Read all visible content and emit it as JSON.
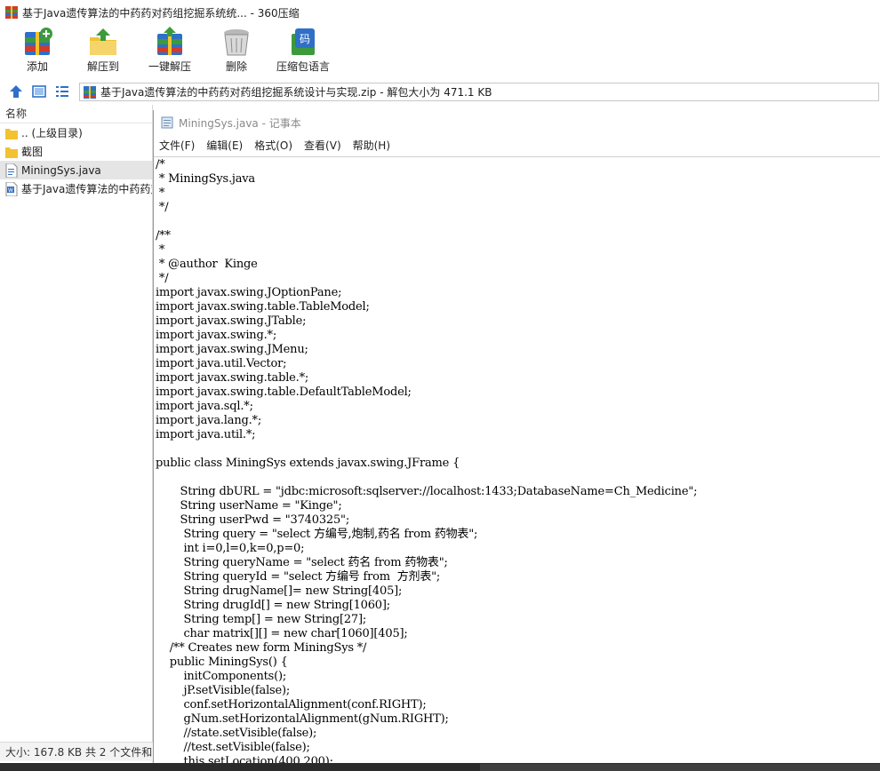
{
  "window": {
    "title": "基于Java遗传算法的中药药对药组挖掘系统统... - 360压缩"
  },
  "toolbar": {
    "buttons": [
      {
        "label": "添加",
        "icon": "add-archive-icon"
      },
      {
        "label": "解压到",
        "icon": "extract-to-folder-icon"
      },
      {
        "label": "一键解压",
        "icon": "one-click-extract-icon"
      },
      {
        "label": "删除",
        "icon": "delete-trash-icon"
      },
      {
        "label": "压缩包语言",
        "icon": "archive-language-code-icon"
      }
    ]
  },
  "addressbar": {
    "path": "基于Java遗传算法的中药药对药组挖掘系统设计与实现.zip - 解包大小为 471.1 KB"
  },
  "filelist": {
    "header": "名称",
    "items": [
      {
        "name": ".. (上级目录)",
        "type": "folder"
      },
      {
        "name": "截图",
        "type": "folder"
      },
      {
        "name": "MiningSys.java",
        "type": "java"
      },
      {
        "name": "基于Java遗传算法的中药药对",
        "type": "doc"
      }
    ]
  },
  "status": {
    "text": "大小: 167.8 KB 共 2 个文件和"
  },
  "notepad": {
    "title": "MiningSys.java - 记事本",
    "menu": [
      "文件(F)",
      "编辑(E)",
      "格式(O)",
      "查看(V)",
      "帮助(H)"
    ],
    "content": "/*\n * MiningSys.java\n *\n */\n\n/**\n *\n * @author  Kinge\n */\nimport javax.swing.JOptionPane;\nimport javax.swing.table.TableModel;\nimport javax.swing.JTable;\nimport javax.swing.*;\nimport javax.swing.JMenu;\nimport java.util.Vector;\nimport javax.swing.table.*;\nimport javax.swing.table.DefaultTableModel;\nimport java.sql.*;\nimport java.lang.*;\nimport java.util.*;\n\npublic class MiningSys extends javax.swing.JFrame {\n\n       String dbURL = \"jdbc:microsoft:sqlserver://localhost:1433;DatabaseName=Ch_Medicine\";\n       String userName = \"Kinge\";\n       String userPwd = \"3740325\";\n        String query = \"select 方编号,炮制,药名 from 药物表\";\n        int i=0,l=0,k=0,p=0;\n        String queryName = \"select 药名 from 药物表\";\n        String queryId = \"select 方编号 from  方剂表\";\n        String drugName[]= new String[405];\n        String drugId[] = new String[1060];\n        String temp[] = new String[27];\n        char matrix[][] = new char[1060][405];\n    /** Creates new form MiningSys */\n    public MiningSys() {\n        initComponents();\n        jP.setVisible(false);\n        conf.setHorizontalAlignment(conf.RIGHT);\n        gNum.setHorizontalAlignment(gNum.RIGHT);\n        //state.setVisible(false);\n        //test.setVisible(false);\n        this.setLocation(400,200);"
  },
  "colors": {
    "green": "#3c9a3c",
    "red": "#d23a2a",
    "blue": "#2f6fc8",
    "yellow": "#f2c230",
    "gray": "#8c8c8c"
  }
}
